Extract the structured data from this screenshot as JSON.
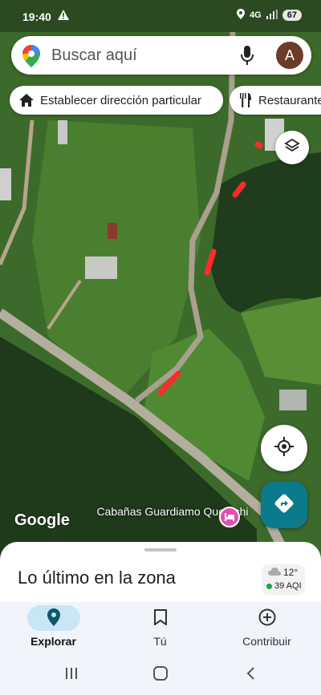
{
  "status_bar": {
    "time": "19:40",
    "alert_icon": "warning-icon",
    "network": "4G",
    "battery": "67"
  },
  "search": {
    "placeholder": "Buscar aquí",
    "avatar_letter": "A"
  },
  "chips": {
    "home": "Establecer dirección particular",
    "restaurants": "Restaurantes"
  },
  "map": {
    "attribution": "Google",
    "place_label": "Cabañas Guardiamo Quemchi"
  },
  "sheet": {
    "title": "Lo último en la zona",
    "temperature": "12°",
    "aqi": "39 AQI"
  },
  "bottom_nav": {
    "items": [
      {
        "label": "Explorar",
        "icon": "explore-pin-icon",
        "active": true
      },
      {
        "label": "Tú",
        "icon": "bookmark-icon",
        "active": false
      },
      {
        "label": "Contribuir",
        "icon": "add-circle-icon",
        "active": false
      }
    ]
  },
  "colors": {
    "accent": "#0b7a8a",
    "route_marks": "#ff2a2a",
    "aqi_good": "#1ea446",
    "place_pin": "#e052b0"
  }
}
